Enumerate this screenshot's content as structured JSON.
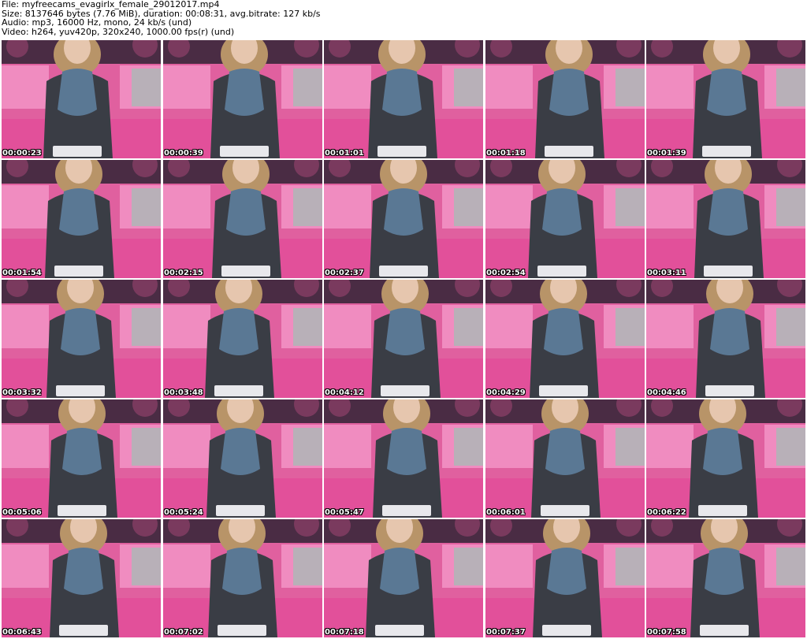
{
  "header": {
    "file_line": "File: myfreecams_evagirlx_female_29012017.mp4",
    "size_line": "Size: 8137646 bytes (7.76 MiB), duration: 00:08:31, avg.bitrate: 127 kb/s",
    "audio_line": "Audio: mp3, 16000 Hz, mono, 24 kb/s (und)",
    "video_line": "Video: h264, yuv420p, 320x240, 1000.00 fps(r) (und)"
  },
  "frames": [
    {
      "timestamp": "00:00:23"
    },
    {
      "timestamp": "00:00:39"
    },
    {
      "timestamp": "00:01:01"
    },
    {
      "timestamp": "00:01:18"
    },
    {
      "timestamp": "00:01:39"
    },
    {
      "timestamp": "00:01:54"
    },
    {
      "timestamp": "00:02:15"
    },
    {
      "timestamp": "00:02:37"
    },
    {
      "timestamp": "00:02:54"
    },
    {
      "timestamp": "00:03:11"
    },
    {
      "timestamp": "00:03:32"
    },
    {
      "timestamp": "00:03:48"
    },
    {
      "timestamp": "00:04:12"
    },
    {
      "timestamp": "00:04:29"
    },
    {
      "timestamp": "00:04:46"
    },
    {
      "timestamp": "00:05:06"
    },
    {
      "timestamp": "00:05:24"
    },
    {
      "timestamp": "00:05:47"
    },
    {
      "timestamp": "00:06:01"
    },
    {
      "timestamp": "00:06:22"
    },
    {
      "timestamp": "00:06:43"
    },
    {
      "timestamp": "00:07:02"
    },
    {
      "timestamp": "00:07:18"
    },
    {
      "timestamp": "00:07:37"
    },
    {
      "timestamp": "00:07:58"
    }
  ],
  "colors": {
    "wall": "#4a2c44",
    "sofa": "#e0609f",
    "sofa_light": "#f08cc0",
    "shirt": "#3a3d45",
    "ruffle": "#5a7894",
    "hair": "#b89468",
    "skin": "#e6c6ae",
    "keyboard": "#e8e8ec"
  }
}
